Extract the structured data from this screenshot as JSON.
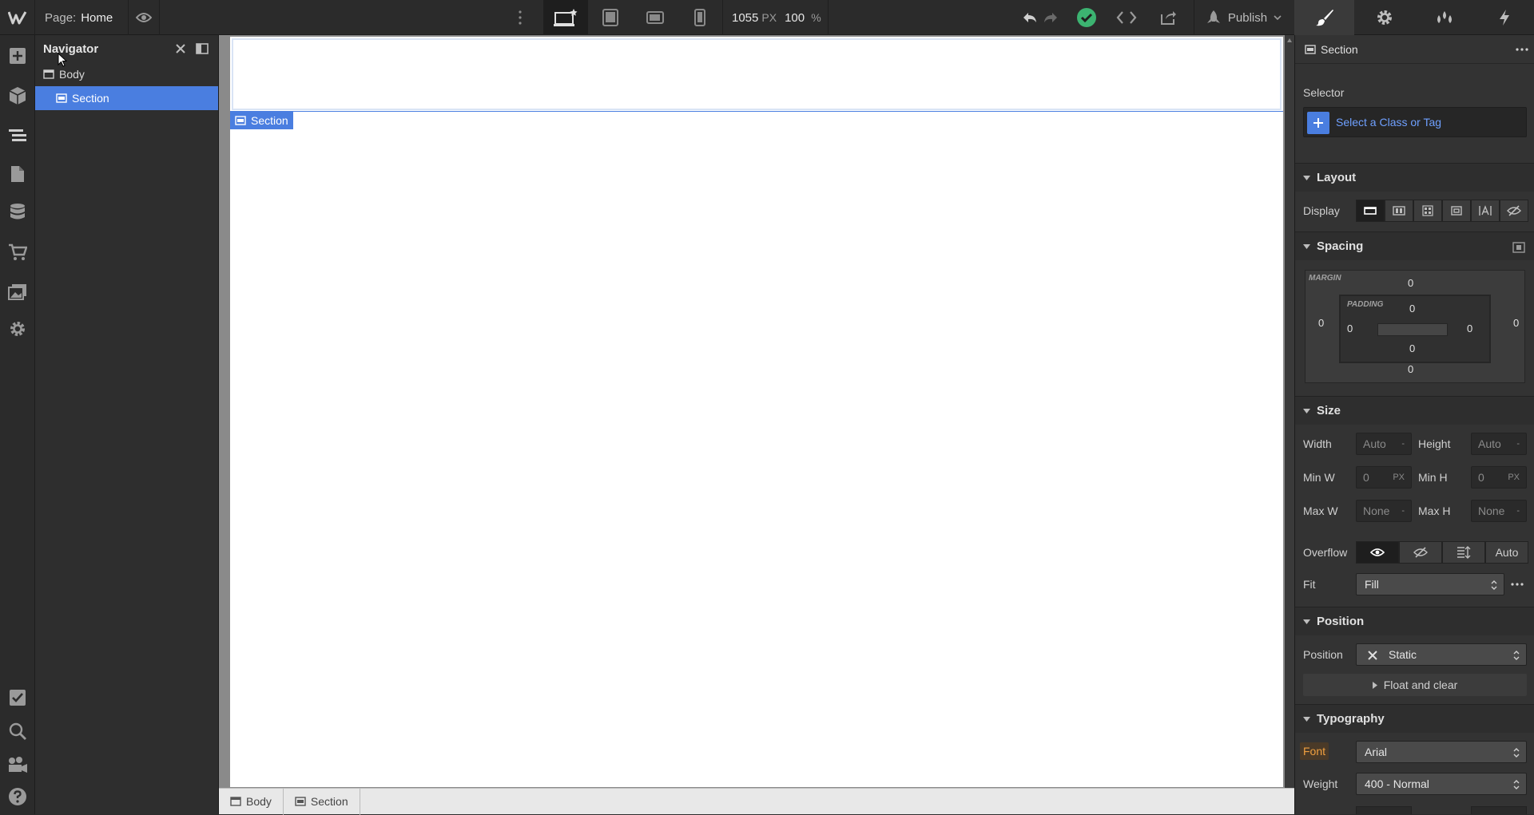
{
  "topbar": {
    "page_prefix": "Page:",
    "page_name": "Home",
    "width_value": "1055",
    "width_unit": "PX",
    "zoom_value": "100",
    "zoom_unit": "%",
    "publish_label": "Publish"
  },
  "navigator": {
    "title": "Navigator",
    "tree": [
      {
        "label": "Body",
        "level": 0,
        "selected": false
      },
      {
        "label": "Section",
        "level": 1,
        "selected": true
      }
    ]
  },
  "canvas": {
    "selected_tag": "Section"
  },
  "breadcrumb": [
    "Body",
    "Section"
  ],
  "style_panel": {
    "element_label": "Section",
    "selector_label": "Selector",
    "selector_placeholder": "Select a Class or Tag",
    "layout": {
      "title": "Layout",
      "display_label": "Display"
    },
    "spacing": {
      "title": "Spacing",
      "margin_label": "MARGIN",
      "padding_label": "PADDING",
      "margin": {
        "top": "0",
        "right": "0",
        "bottom": "0",
        "left": "0"
      },
      "padding": {
        "top": "0",
        "right": "0",
        "bottom": "0",
        "left": "0"
      }
    },
    "size": {
      "title": "Size",
      "width_label": "Width",
      "width_value": "Auto",
      "width_unit": "-",
      "height_label": "Height",
      "height_value": "Auto",
      "height_unit": "-",
      "minw_label": "Min W",
      "minw_value": "0",
      "minw_unit": "PX",
      "minh_label": "Min H",
      "minh_value": "0",
      "minh_unit": "PX",
      "maxw_label": "Max W",
      "maxw_value": "None",
      "maxw_unit": "-",
      "maxh_label": "Max H",
      "maxh_value": "None",
      "maxh_unit": "-",
      "overflow_label": "Overflow",
      "overflow_auto": "Auto",
      "fit_label": "Fit",
      "fit_value": "Fill"
    },
    "position": {
      "title": "Position",
      "position_label": "Position",
      "position_value": "Static",
      "float_label": "Float and clear"
    },
    "typography": {
      "title": "Typography",
      "font_label": "Font",
      "font_value": "Arial",
      "weight_label": "Weight",
      "weight_value": "400 - Normal"
    }
  },
  "colors": {
    "accent": "#4a7ee0",
    "ok": "#3cb371",
    "font_label": "#f0a040"
  }
}
